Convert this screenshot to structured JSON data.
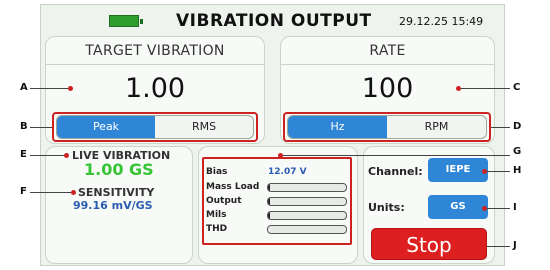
{
  "header": {
    "title": "VIBRATION OUTPUT",
    "datetime": "29.12.25 15:49",
    "battery_color": "#2e9e2e"
  },
  "target": {
    "label": "TARGET VIBRATION",
    "value": "1.00",
    "options": [
      "Peak",
      "RMS"
    ],
    "selected": "Peak"
  },
  "rate": {
    "label": "RATE",
    "value": "100",
    "options": [
      "Hz",
      "RPM"
    ],
    "selected": "Hz"
  },
  "live": {
    "label": "LIVE VIBRATION",
    "value": "1.00 GS",
    "sensitivity_label": "SENSITIVITY",
    "sensitivity_value": "99.16 mV/GS"
  },
  "diagnostics": {
    "bias_label": "Bias",
    "bias_value": "12.07 V",
    "bars": [
      {
        "label": "Mass Load",
        "fill": 0.02
      },
      {
        "label": "Output",
        "fill": 0.02
      },
      {
        "label": "Mils",
        "fill": 0.02
      },
      {
        "label": "THD",
        "fill": 0.0
      }
    ]
  },
  "channel": {
    "label": "Channel:",
    "value": "IEPE",
    "units_label": "Units:",
    "units_value": "GS",
    "stop_label": "Stop"
  },
  "callouts": [
    "A",
    "B",
    "C",
    "D",
    "E",
    "F",
    "G",
    "H",
    "I",
    "J"
  ],
  "colors": {
    "accent_blue": "#2f86d6",
    "stop_red": "#dd1f1f",
    "live_green": "#36c436",
    "callout_red": "#cc2222"
  }
}
